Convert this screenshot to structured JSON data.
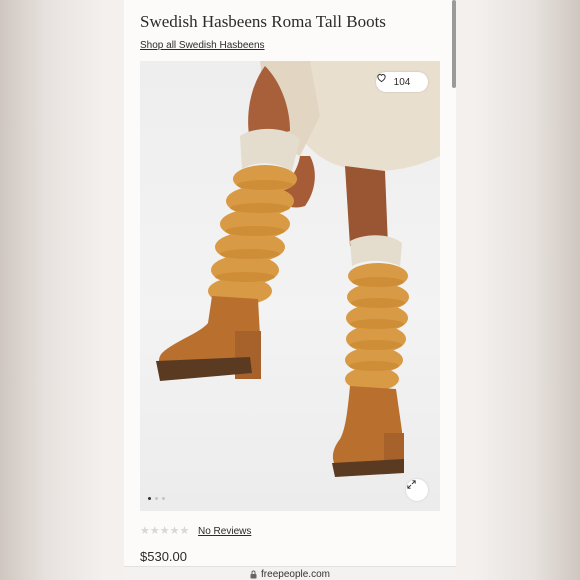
{
  "product": {
    "title": "Swedish Hasbeens Roma Tall Boots",
    "shop_link": "Shop all Swedish Hasbeens",
    "like_count": "104",
    "rating_stars": "★★★★★",
    "rating": 0,
    "reviews_label": "No Reviews",
    "price": "$530.00"
  },
  "gallery": {
    "image_count": 3,
    "active_index": 0
  },
  "browser": {
    "url": "freepeople.com"
  },
  "icons": {
    "like": "heart-icon",
    "expand": "expand-icon",
    "lock": "lock-icon"
  },
  "colors": {
    "accent": "#2b2b2b",
    "stars_empty": "#d9d6d4"
  }
}
